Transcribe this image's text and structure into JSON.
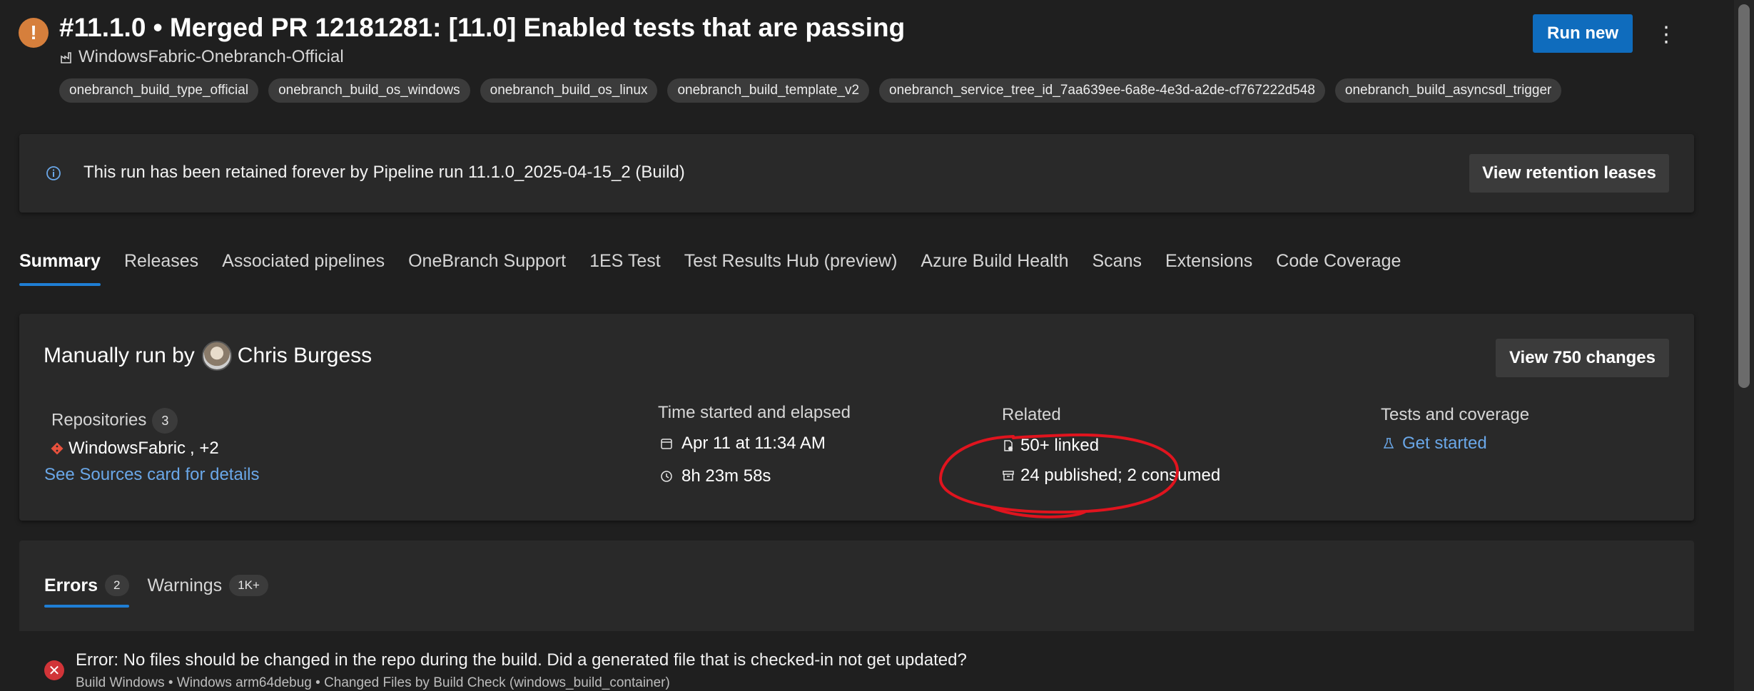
{
  "header": {
    "status_glyph": "!",
    "title": "#11.1.0 • Merged PR 12181281: [11.0] Enabled tests that are passing",
    "pipeline": "WindowsFabric-Onebranch-Official",
    "run_new_label": "Run new",
    "more_glyph": "⋮",
    "tags": [
      "onebranch_build_type_official",
      "onebranch_build_os_windows",
      "onebranch_build_os_linux",
      "onebranch_build_template_v2",
      "onebranch_service_tree_id_7aa639ee-6a8e-4e3d-a2de-cf767222d548",
      "onebranch_build_asyncsdl_trigger"
    ]
  },
  "banner": {
    "text": "This run has been retained forever by Pipeline run 11.1.0_2025-04-15_2 (Build)",
    "button_label": "View retention leases"
  },
  "tabs": [
    {
      "label": "Summary",
      "active": true
    },
    {
      "label": "Releases"
    },
    {
      "label": "Associated pipelines"
    },
    {
      "label": "OneBranch Support"
    },
    {
      "label": "1ES Test"
    },
    {
      "label": "Test Results Hub (preview)"
    },
    {
      "label": "Azure Build Health"
    },
    {
      "label": "Scans"
    },
    {
      "label": "Extensions"
    },
    {
      "label": "Code Coverage"
    }
  ],
  "summary": {
    "run_by_prefix": "Manually run by",
    "run_by_user": "Chris Burgess",
    "view_changes_label": "View 750 changes",
    "repositories": {
      "label": "Repositories",
      "count": "3",
      "repo_name": "WindowsFabric",
      "more": ", +2",
      "sources_link": "See Sources card for details"
    },
    "time": {
      "label": "Time started and elapsed",
      "started": "Apr 11 at 11:34 AM",
      "elapsed": "8h 23m 58s"
    },
    "related": {
      "label": "Related",
      "linked": "50+ linked",
      "artifacts": "24 published; 2 consumed"
    },
    "tests": {
      "label": "Tests and coverage",
      "link": "Get started"
    }
  },
  "issues": {
    "errors_label": "Errors",
    "errors_count": "2",
    "warnings_label": "Warnings",
    "warnings_count": "1K+",
    "error_glyph": "✕",
    "first_error": {
      "message": "Error: No files should be changed in the repo during the build. Did a generated file that is checked-in not get updated?",
      "source": "Build Windows • Windows arm64debug • Changed Files by Build Check (windows_build_container)"
    }
  },
  "colors": {
    "background": "#1f1f1f",
    "card": "#292929",
    "primary_button": "#0f6cbd",
    "link": "#6aa7e8",
    "status_warning": "#d67f3c",
    "error": "#d13438",
    "annotation": "#e0141e"
  }
}
